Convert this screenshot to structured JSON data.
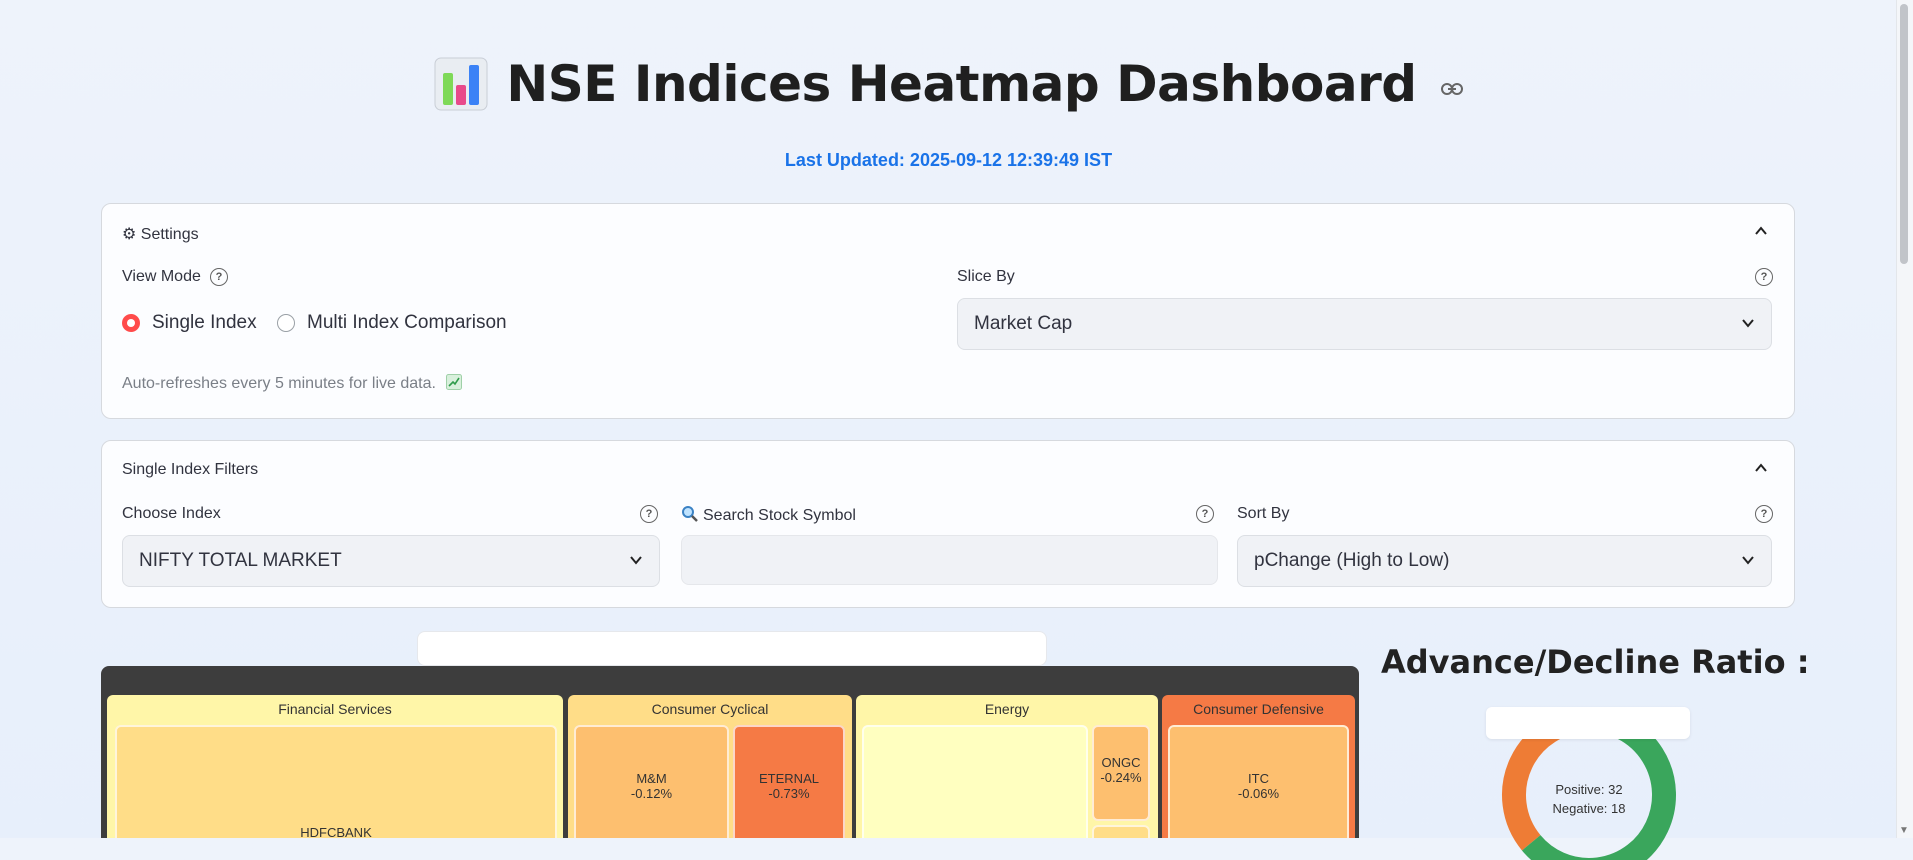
{
  "header": {
    "title": "NSE Indices Heatmap Dashboard",
    "last_updated": "Last Updated: 2025-09-12 12:39:49 IST",
    "title_icon": "bar-chart-icon",
    "link_icon": "link-icon"
  },
  "settings": {
    "title": "⚙ Settings",
    "view_mode_label": "View Mode",
    "view_mode_options": [
      "Single Index",
      "Multi Index Comparison"
    ],
    "view_mode_selected": "Single Index",
    "slice_by_label": "Slice By",
    "slice_by_value": "Market Cap",
    "caption": "Auto-refreshes every 5 minutes for live data."
  },
  "filters": {
    "title": "Single Index Filters",
    "choose_index_label": "Choose Index",
    "choose_index_value": "NIFTY TOTAL MARKET",
    "search_label": "Search Stock Symbol",
    "search_value": "",
    "sort_by_label": "Sort By",
    "sort_by_value": "pChange (High to Low)"
  },
  "heatmap": {
    "sectors": [
      {
        "name": "Financial Services",
        "color": "#fff6a8"
      },
      {
        "name": "Consumer Cyclical",
        "color": "#ffdd88"
      },
      {
        "name": "Energy",
        "color": "#fff6a8"
      },
      {
        "name": "Consumer Defensive",
        "color": "#f57a45"
      }
    ],
    "tiles": [
      {
        "symbol": "HDFCBANK",
        "change": "",
        "color": "#ffdd88"
      },
      {
        "symbol": "M&M",
        "change": "-0.12%",
        "color": "#fdbf6f"
      },
      {
        "symbol": "ETERNAL",
        "change": "-0.73%",
        "color": "#f57a45"
      },
      {
        "symbol": "",
        "change": "",
        "color": "#ffffc0"
      },
      {
        "symbol": "ONGC",
        "change": "-0.24%",
        "color": "#fdbf6f"
      },
      {
        "symbol": "ITC",
        "change": "-0.06%",
        "color": "#fdbf6f"
      }
    ]
  },
  "advance_decline": {
    "title": "Advance/Decline Ratio :",
    "positive_text": "Positive: 32",
    "negative_text": "Negative: 18",
    "positive": 32,
    "negative": 18,
    "positive_color": "#3aa65c",
    "negative_color": "#ee7c35"
  }
}
